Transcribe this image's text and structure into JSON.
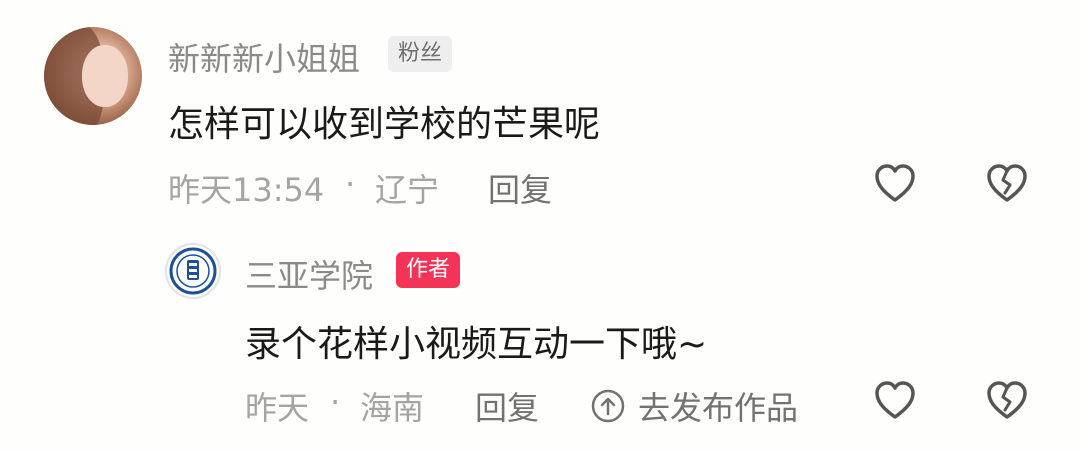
{
  "comment": {
    "username": "新新新小姐姐",
    "badge": "粉丝",
    "text": "怎样可以收到学校的芒果呢",
    "time": "昨天13:54",
    "sep": "·",
    "location": "辽宁",
    "reply_label": "回复"
  },
  "reply": {
    "username": "三亚学院",
    "badge": "作者",
    "text": "录个花样小视频互动一下哦~",
    "time": "昨天",
    "sep": "·",
    "location": "海南",
    "reply_label": "回复",
    "share_label": "去发布作品"
  },
  "icons": {
    "like": "heart-outline-icon",
    "dislike": "broken-heart-icon",
    "share": "up-arrow-circle-icon"
  },
  "colors": {
    "author_badge": "#f43457",
    "fan_badge_bg": "#eeeeee"
  }
}
